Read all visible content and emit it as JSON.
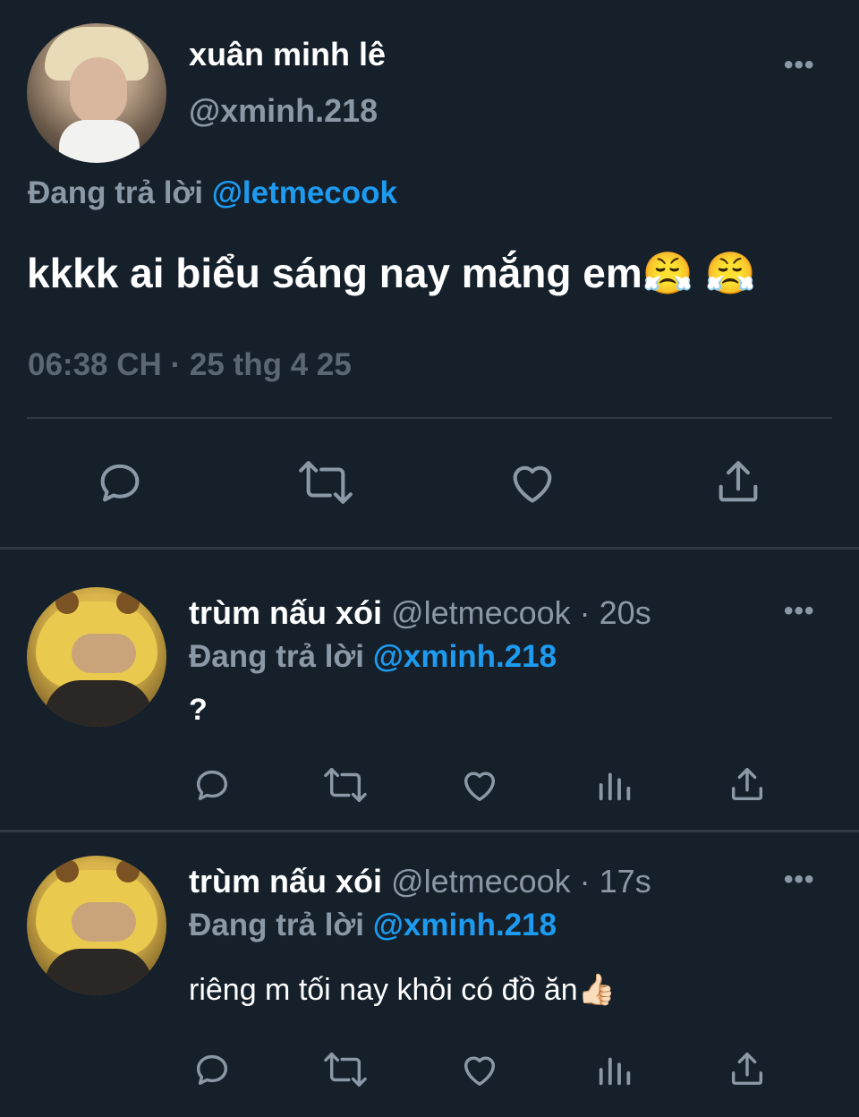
{
  "main_tweet": {
    "display_name": "xuân minh lê",
    "handle": "@xminh.218",
    "replying_prefix": "Đang trả lời ",
    "replying_to": "@letmecook",
    "text": "kkkk ai biểu sáng nay mắng em😤 😤",
    "timestamp": "06:38 CH · 25 thg 4 25",
    "more_label": "•••"
  },
  "replies": [
    {
      "display_name": "trùm nấu xói",
      "meta": " @letmecook · 20s",
      "replying_prefix": "Đang trả lời ",
      "replying_to": "@xminh.218",
      "text": "?",
      "more_label": "•••"
    },
    {
      "display_name": "trùm nấu xói",
      "meta": " @letmecook · 17s",
      "replying_prefix": "Đang trả lời ",
      "replying_to": "@xminh.218",
      "text": "riêng m tối nay khỏi có đồ ăn👍🏻",
      "more_label": "•••"
    }
  ],
  "icons": {
    "main_actions": [
      "reply-icon",
      "retweet-icon",
      "like-icon",
      "share-icon"
    ],
    "reply_actions": [
      "reply-icon",
      "retweet-icon",
      "like-icon",
      "views-icon",
      "share-icon"
    ]
  },
  "colors": {
    "background": "#15202b",
    "text": "#ffffff",
    "secondary": "#8b98a5",
    "accent": "#1d9bf0",
    "divider": "#2f3a45"
  }
}
